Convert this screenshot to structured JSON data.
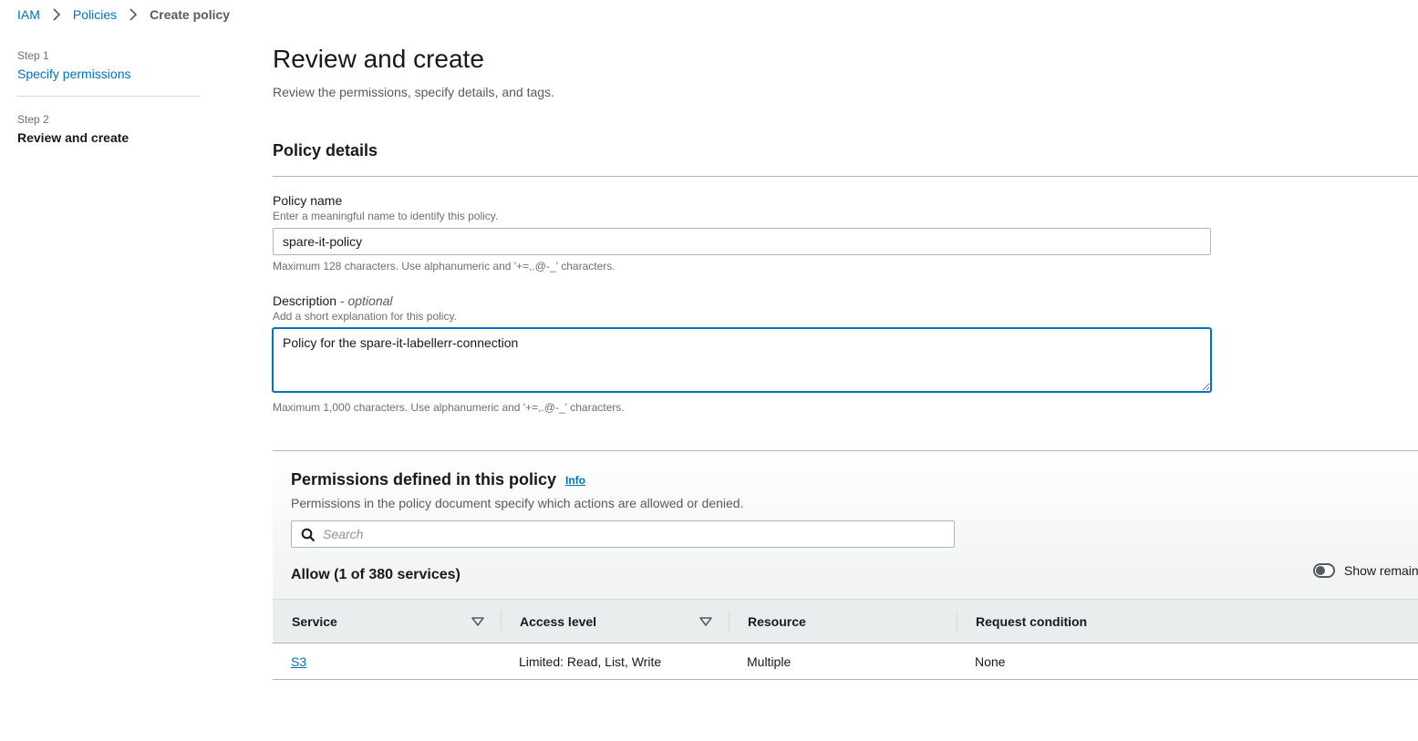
{
  "breadcrumb": {
    "items": [
      "IAM",
      "Policies"
    ],
    "current": "Create policy"
  },
  "steps": [
    {
      "label": "Step 1",
      "title": "Specify permissions"
    },
    {
      "label": "Step 2",
      "title": "Review and create"
    }
  ],
  "page": {
    "title": "Review and create",
    "description": "Review the permissions, specify details, and tags."
  },
  "policy_details": {
    "title": "Policy details",
    "name": {
      "label": "Policy name",
      "hint": "Enter a meaningful name to identify this policy.",
      "value": "spare-it-policy",
      "constraint": "Maximum 128 characters. Use alphanumeric and '+=,.@-_' characters."
    },
    "description": {
      "label": "Description",
      "label_optional": "- optional",
      "hint": "Add a short explanation for this policy.",
      "value": "Policy for the spare-it-labellerr-connection",
      "constraint": "Maximum 1,000 characters. Use alphanumeric and '+=,.@-_' characters."
    }
  },
  "permissions": {
    "title": "Permissions defined in this policy",
    "info_label": "Info",
    "description": "Permissions in the policy document specify which actions are allowed or denied.",
    "search_placeholder": "Search",
    "allow_title": "Allow (1 of 380 services)",
    "toggle_label": "Show remain",
    "columns": [
      "Service",
      "Access level",
      "Resource",
      "Request condition"
    ],
    "rows": [
      {
        "service": "S3",
        "access_level": "Limited: Read, List, Write",
        "resource": "Multiple",
        "request_condition": "None"
      }
    ]
  },
  "colors": {
    "link": "#0073bb",
    "text": "#16191f",
    "muted": "#687078",
    "focus": "#0073bb"
  }
}
